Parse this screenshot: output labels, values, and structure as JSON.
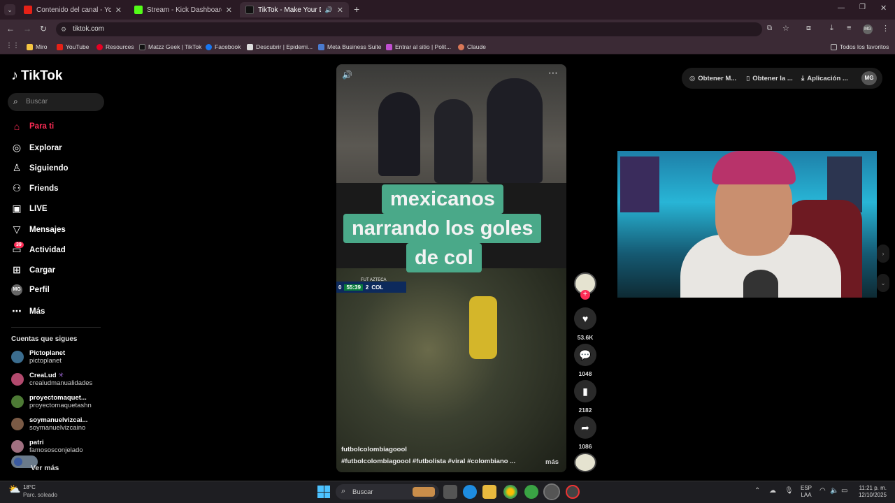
{
  "browser": {
    "tabs": [
      {
        "title": "Contenido del canal - YouTube",
        "color": "#e62117"
      },
      {
        "title": "Stream - Kick Dashboard",
        "color": "#53fc18"
      },
      {
        "title": "TikTok - Make Your Day",
        "color": "#111111"
      }
    ],
    "url": "tiktok.com",
    "bookmarks": [
      "Miro",
      "YouTube",
      "Resources",
      "Matzz Geek | TikTok",
      "Facebook",
      "Descubrir | Epidemi...",
      "Meta Business Suite",
      "Entrar al sitio | Polit...",
      "Claude"
    ],
    "bookmarks_right": "Todos los favoritos"
  },
  "tiktok": {
    "logo": "TikTok",
    "search_placeholder": "Buscar",
    "nav": [
      {
        "label": "Para ti",
        "icon": "home-icon",
        "glyph": "⌂"
      },
      {
        "label": "Explorar",
        "icon": "compass-icon",
        "glyph": "◎"
      },
      {
        "label": "Siguiendo",
        "icon": "following-icon",
        "glyph": "♙"
      },
      {
        "label": "Friends",
        "icon": "friends-icon",
        "glyph": "⚇"
      },
      {
        "label": "LIVE",
        "icon": "live-icon",
        "glyph": "▣"
      },
      {
        "label": "Mensajes",
        "icon": "messages-icon",
        "glyph": "▽"
      },
      {
        "label": "Actividad",
        "icon": "activity-icon",
        "glyph": "▭"
      },
      {
        "label": "Cargar",
        "icon": "upload-icon",
        "glyph": "⊞"
      },
      {
        "label": "Perfil",
        "icon": "profile-icon",
        "glyph": "MG"
      },
      {
        "label": "Más",
        "icon": "more-icon",
        "glyph": "⋯"
      }
    ],
    "activity_badge": "39",
    "following_title": "Cuentas que sigues",
    "accounts": [
      {
        "name": "Pictoplanet",
        "handle": "pictoplanet",
        "color": "#3b6d8f"
      },
      {
        "name": "CreaLud",
        "handle": "crealudmanualidades",
        "color": "#b34a6e"
      },
      {
        "name": "proyectomaquet...",
        "handle": "proyectomaquetashn",
        "color": "#4d7a35"
      },
      {
        "name": "soymanuelvizcai...",
        "handle": "soymanuelvizcaino",
        "color": "#7a5a45"
      },
      {
        "name": "patri",
        "handle": "famososconjelado",
        "color": "#a07080"
      }
    ],
    "see_more": "Ver más",
    "top_buttons": [
      "Obtener M...",
      "Obtener la ...",
      "Aplicación ..."
    ],
    "profile_initials": "MG",
    "video": {
      "caption_lines": [
        "mexicanos",
        "narrando los goles",
        "de col"
      ],
      "scoreboard": {
        "channel": "FUT AZTECA",
        "time": "55:39",
        "home_score": "0",
        "away_score": "2",
        "away": "COL"
      },
      "author": "futbolcolombiagoool",
      "hashtags": "#futbolcolombiagoool #futbolista #viral #colombiano ...",
      "more": "más"
    },
    "actions": {
      "likes": "53.6K",
      "comments": "1048",
      "saves": "2182",
      "shares": "1086"
    }
  },
  "taskbar": {
    "weather_temp": "18°C",
    "weather_desc": "Parc. soleado",
    "search": "Buscar",
    "lang1": "ESP",
    "lang2": "LAA",
    "time": "11:21 p. m.",
    "date": "12/10/2025"
  }
}
